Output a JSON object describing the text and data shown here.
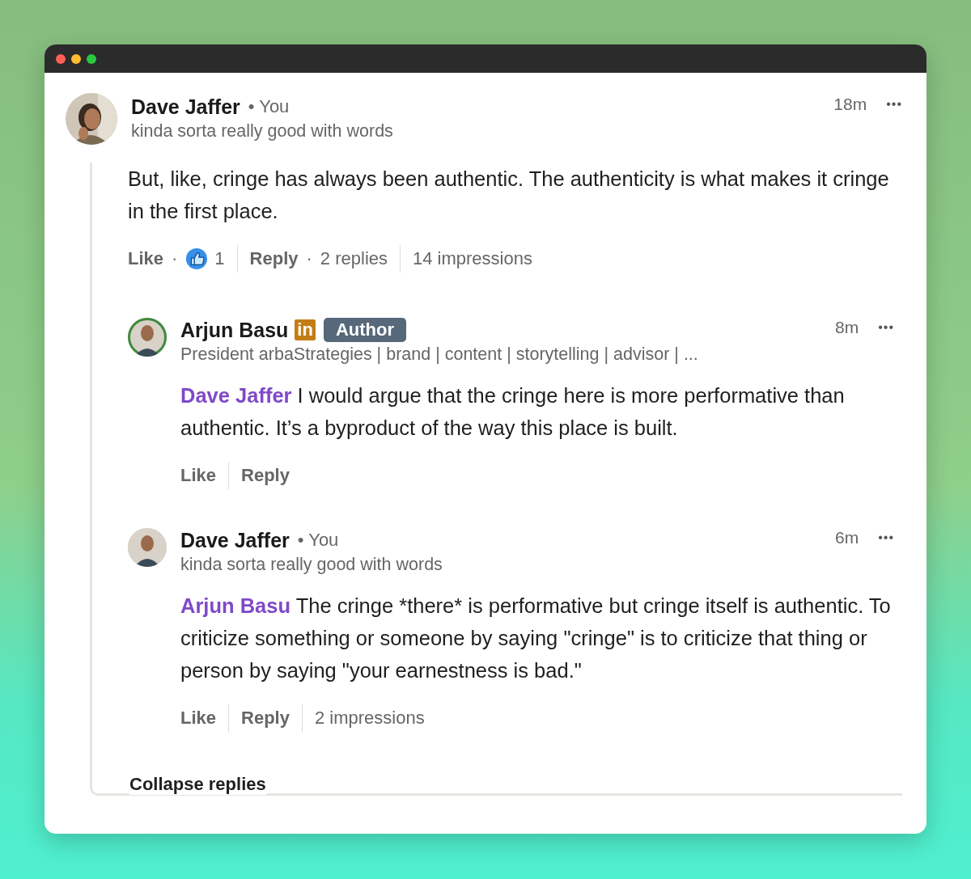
{
  "comment": {
    "author": "Dave Jaffer",
    "separator": "•",
    "you_label": "You",
    "headline": "kinda sorta really good with words",
    "time": "18m",
    "more": "•••",
    "text": [
      {
        "kind": "plain",
        "text": "But, like, cringe has always been authentic. The authenticity is what makes it cringe in the first place."
      }
    ],
    "actions": [
      [
        {
          "kind": "action",
          "text": "Like"
        },
        {
          "kind": "dot",
          "text": "·"
        },
        {
          "kind": "reaction",
          "text": "1"
        }
      ],
      [
        {
          "kind": "action",
          "text": "Reply"
        },
        {
          "kind": "dot",
          "text": "·"
        },
        {
          "kind": "meta",
          "text": "2 replies"
        }
      ],
      [
        {
          "kind": "meta",
          "text": "14 impressions"
        }
      ]
    ],
    "replies": [
      {
        "author": "Arjun Basu",
        "premium_badge": "in",
        "author_badge": "Author",
        "headline": "President arbaStrategies | brand | content | storytelling | advisor | ...",
        "time": "8m",
        "more": "•••",
        "text": [
          {
            "kind": "mention",
            "text": "Dave Jaffer"
          },
          {
            "kind": "plain",
            "text": " I would argue that the cringe here is more performative than authentic. It’s a byproduct of the way this place is built."
          }
        ],
        "actions": [
          [
            {
              "kind": "action",
              "text": "Like"
            }
          ],
          [
            {
              "kind": "action",
              "text": "Reply"
            }
          ]
        ]
      },
      {
        "author": "Dave Jaffer",
        "separator": "•",
        "you_label": "You",
        "headline": "kinda sorta really good with words",
        "time": "6m",
        "more": "•••",
        "text": [
          {
            "kind": "mention",
            "text": "Arjun Basu"
          },
          {
            "kind": "plain",
            "text": " The cringe *there* is performative but cringe itself is authentic. To criticize something or someone by saying \"cringe\" is to criticize that thing or person by saying \"your earnestness is bad.\""
          }
        ],
        "actions": [
          [
            {
              "kind": "action",
              "text": "Like"
            }
          ],
          [
            {
              "kind": "action",
              "text": "Reply"
            }
          ],
          [
            {
              "kind": "meta",
              "text": "2 impressions"
            }
          ]
        ]
      }
    ],
    "collapse": "Collapse replies"
  }
}
